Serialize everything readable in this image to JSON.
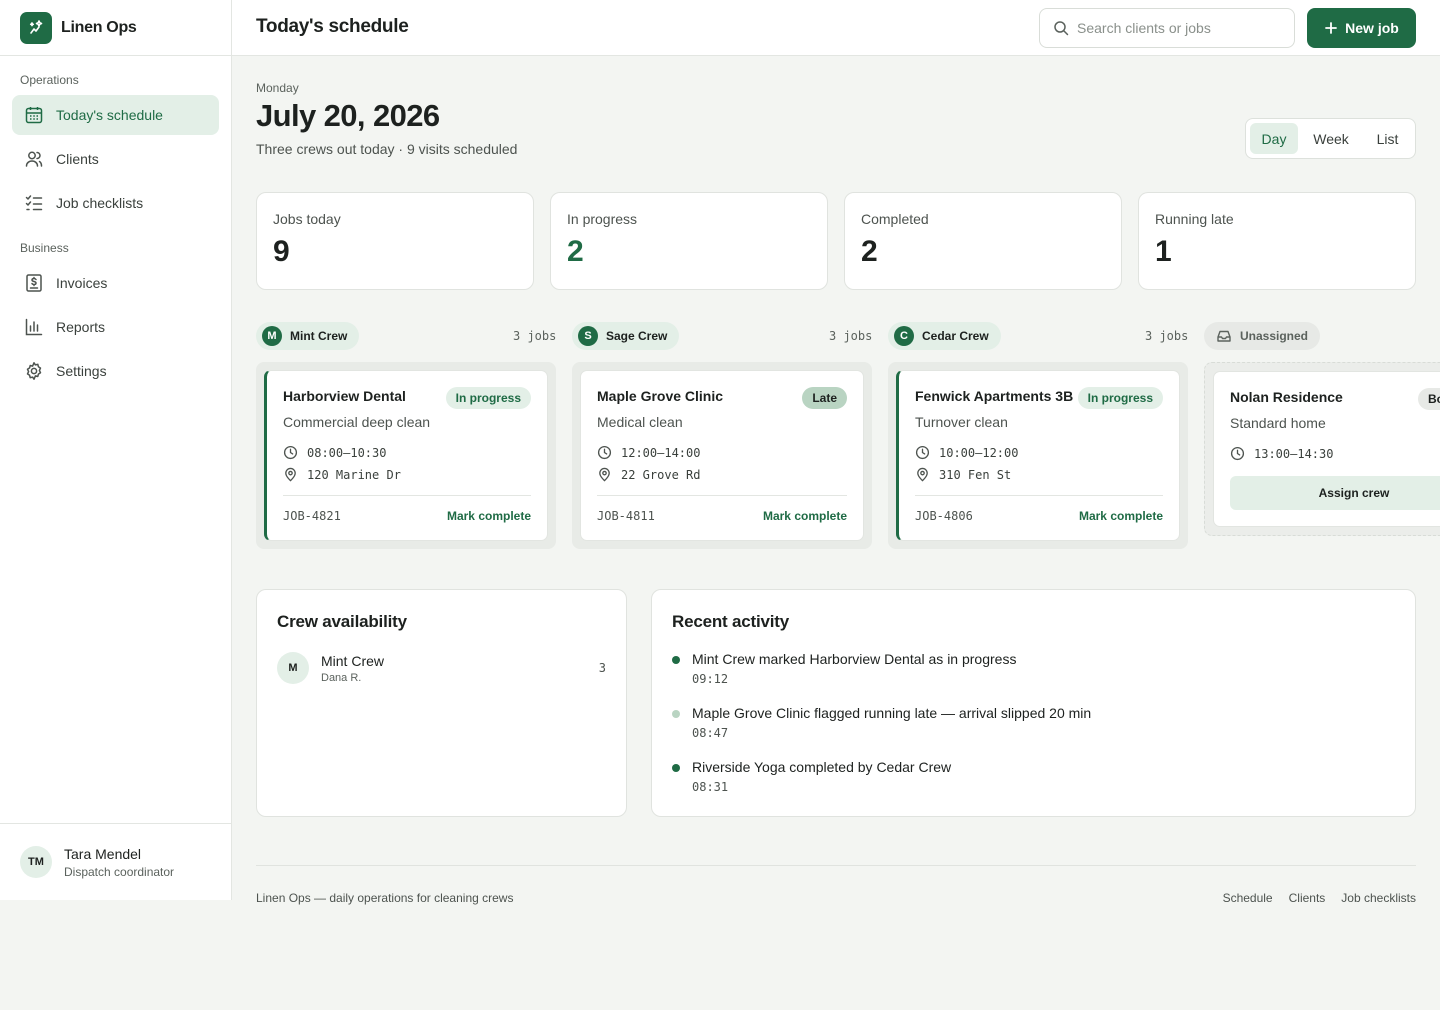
{
  "app": {
    "name": "Linen Ops"
  },
  "sidebar": {
    "sections": [
      {
        "label": "Operations",
        "items": [
          {
            "label": "Today's schedule",
            "icon": "calendar-icon",
            "active": true
          },
          {
            "label": "Clients",
            "icon": "users-icon"
          },
          {
            "label": "Job checklists",
            "icon": "checklist-icon"
          }
        ]
      },
      {
        "label": "Business",
        "items": [
          {
            "label": "Invoices",
            "icon": "invoice-icon"
          },
          {
            "label": "Reports",
            "icon": "bar-chart-icon"
          },
          {
            "label": "Settings",
            "icon": "gear-icon"
          }
        ]
      }
    ],
    "user": {
      "initials": "TM",
      "name": "Tara Mendel",
      "role": "Dispatch coordinator"
    }
  },
  "header": {
    "title": "Today's schedule",
    "search_placeholder": "Search clients or jobs",
    "new_job_label": "New job"
  },
  "date": {
    "weekday": "Monday",
    "title": "July 20, 2026",
    "subtitle": "Three crews out today · 9 visits scheduled"
  },
  "view_toggle": {
    "options": [
      "Day",
      "Week",
      "List"
    ],
    "selected": "Day"
  },
  "stats": [
    {
      "label": "Jobs today",
      "value": "9"
    },
    {
      "label": "In progress",
      "value": "2"
    },
    {
      "label": "Completed",
      "value": "2"
    },
    {
      "label": "Running late",
      "value": "1"
    }
  ],
  "crews": [
    {
      "initial": "M",
      "name": "Mint Crew",
      "count": "3 jobs",
      "card": {
        "title": "Harborview Dental",
        "badge": "In progress",
        "service": "Commercial deep clean",
        "time": "08:00–10:30",
        "address": "120 Marine Dr",
        "job_id": "JOB-4821",
        "action": "Mark complete"
      }
    },
    {
      "initial": "S",
      "name": "Sage Crew",
      "count": "3 jobs",
      "card": {
        "title": "Maple Grove Clinic",
        "badge": "Late",
        "service": "Medical clean",
        "time": "12:00–14:00",
        "address": "22 Grove Rd",
        "job_id": "JOB-4811",
        "action": "Mark complete"
      }
    },
    {
      "initial": "C",
      "name": "Cedar Crew",
      "count": "3 jobs",
      "card": {
        "title": "Fenwick Apartments 3B",
        "badge": "In progress",
        "service": "Turnover clean",
        "time": "10:00–12:00",
        "address": "310 Fen St",
        "job_id": "JOB-4806",
        "action": "Mark complete"
      }
    }
  ],
  "unassigned": {
    "label": "Unassigned",
    "card": {
      "title": "Nolan Residence",
      "badge": "Bo",
      "service": "Standard home",
      "time": "13:00–14:30",
      "action": "Assign crew"
    }
  },
  "crew_availability": {
    "title": "Crew availability",
    "rows": [
      {
        "initial": "M",
        "name": "Mint Crew",
        "lead": "Dana R.",
        "count": "3"
      }
    ]
  },
  "recent_activity": {
    "title": "Recent activity",
    "items": [
      {
        "text": "Mint Crew marked Harborview Dental as in progress",
        "time": "09:12"
      },
      {
        "text": "Maple Grove Clinic flagged running late — arrival slipped 20 min",
        "time": "08:47"
      },
      {
        "text": "Riverside Yoga completed by Cedar Crew",
        "time": "08:31"
      }
    ]
  },
  "footer": {
    "text": "Linen Ops — daily operations for cleaning crews",
    "links": [
      "Schedule",
      "Clients",
      "Job checklists"
    ]
  },
  "colors": {
    "accent": "#1f6b45",
    "accent_light": "#e3efe7",
    "late_badge": "#b9d4c2",
    "background": "#f3f5f2"
  }
}
